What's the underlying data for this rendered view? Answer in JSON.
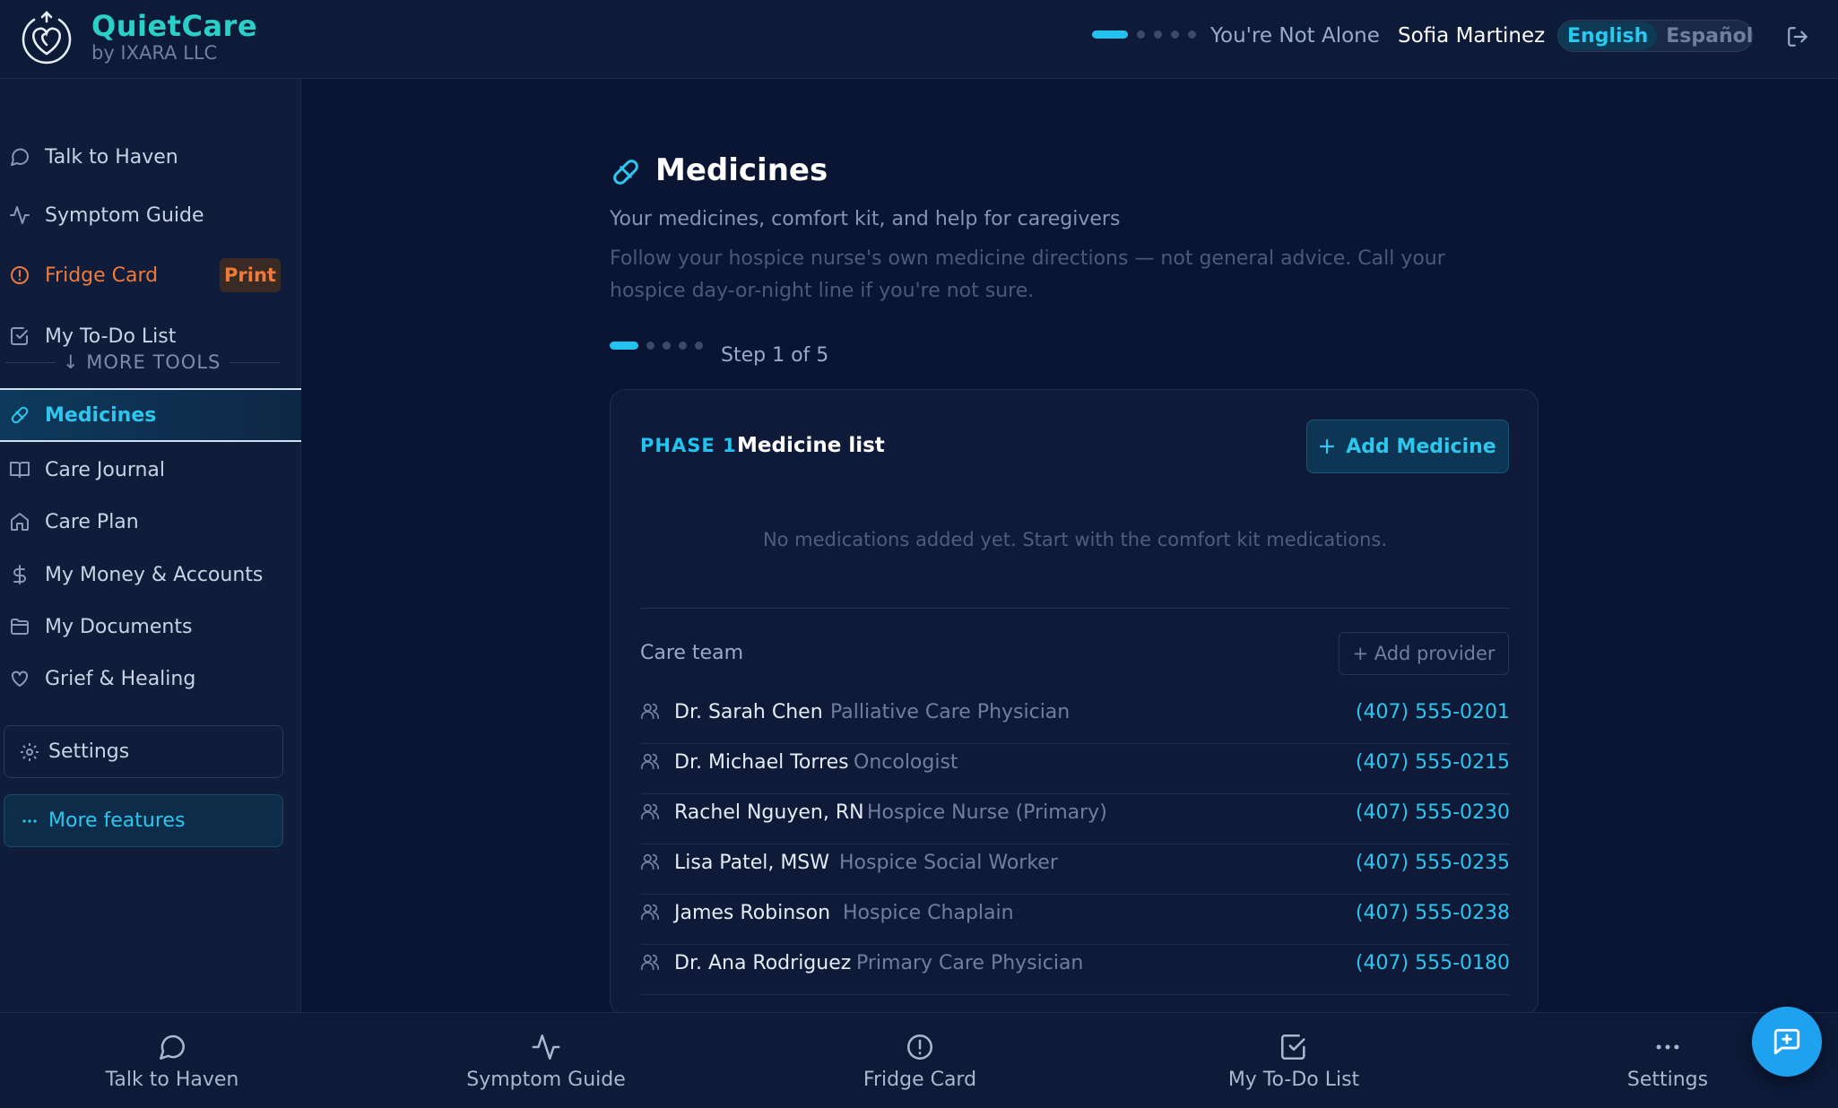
{
  "header": {
    "brand_name": "QuietCare",
    "brand_sub": "by IXARA LLC",
    "motto": "You're Not Alone",
    "user_name": "Sofia Martinez",
    "lang_active": "English",
    "lang_other": "Español"
  },
  "sidebar": {
    "items": [
      {
        "label": "Talk to Haven",
        "icon": "chat-bubble-icon"
      },
      {
        "label": "Symptom Guide",
        "icon": "activity-pulse-icon"
      },
      {
        "label": "Fridge Card",
        "icon": "alert-circle-icon",
        "badge": "Print"
      },
      {
        "label": "My To-Do List",
        "icon": "checkbox-icon"
      }
    ],
    "more_tools_label": "↓ MORE TOOLS",
    "tools": [
      {
        "label": "Medicines",
        "icon": "pill-icon",
        "active": true
      },
      {
        "label": "Care Journal",
        "icon": "book-icon"
      },
      {
        "label": "Care Plan",
        "icon": "home-icon"
      },
      {
        "label": "My Money & Accounts",
        "icon": "dollar-icon"
      },
      {
        "label": "My Documents",
        "icon": "folder-icon"
      },
      {
        "label": "Grief & Healing",
        "icon": "heart-icon"
      }
    ],
    "settings_label": "Settings",
    "more_features_label": "More features"
  },
  "main": {
    "title": "Medicines",
    "subtitle": "Your medicines, comfort kit, and help for caregivers",
    "note": "Follow your hospice nurse's own medicine directions — not general advice. Call your hospice day-or-night line if you're not sure.",
    "step_label": "Step 1 of 5",
    "step_current": 1,
    "step_total": 5
  },
  "card": {
    "phase_tag": "PHASE 1",
    "phase_title": "Medicine list",
    "add_medicine_label": "Add Medicine",
    "empty_message": "No medications added yet. Start with the comfort kit medications.",
    "care_team_label": "Care team",
    "add_provider_label": "+ Add provider",
    "providers": [
      {
        "name": "Dr. Sarah Chen",
        "role": "Palliative Care Physician",
        "phone": "(407) 555-0201"
      },
      {
        "name": "Dr. Michael Torres",
        "role": "Oncologist",
        "phone": "(407) 555-0215"
      },
      {
        "name": "Rachel Nguyen, RN",
        "role": "Hospice Nurse (Primary)",
        "phone": "(407) 555-0230"
      },
      {
        "name": "Lisa Patel, MSW",
        "role": "Hospice Social Worker",
        "phone": "(407) 555-0235"
      },
      {
        "name": "James Robinson",
        "role": "Hospice Chaplain",
        "phone": "(407) 555-0238"
      },
      {
        "name": "Dr. Ana Rodriguez",
        "role": "Primary Care Physician",
        "phone": "(407) 555-0180"
      }
    ]
  },
  "bottom_nav": [
    {
      "label": "Talk to Haven",
      "icon": "chat-bubble-icon"
    },
    {
      "label": "Symptom Guide",
      "icon": "activity-pulse-icon"
    },
    {
      "label": "Fridge Card",
      "icon": "alert-circle-icon"
    },
    {
      "label": "My To-Do List",
      "icon": "checkbox-icon"
    },
    {
      "label": "Settings",
      "icon": "more-dots-icon"
    }
  ],
  "colors": {
    "accent": "#22c3ef",
    "background": "#0a1533",
    "brand": "#2ad0c8",
    "warning": "#f07a3a"
  }
}
